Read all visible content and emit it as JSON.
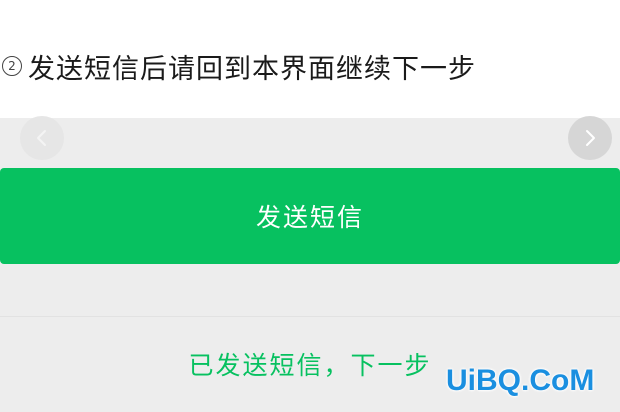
{
  "step": {
    "number": "2",
    "text": "发送短信后请回到本界面继续下一步"
  },
  "buttons": {
    "send_sms": "发送短信",
    "sent_next": "已发送短信，下一步"
  },
  "nav": {
    "prev_icon": "chevron-left-icon",
    "next_icon": "chevron-right-icon"
  },
  "watermark": "UiBQ.CoM",
  "colors": {
    "accent": "#07c160",
    "watermark": "#1a8fe0"
  }
}
